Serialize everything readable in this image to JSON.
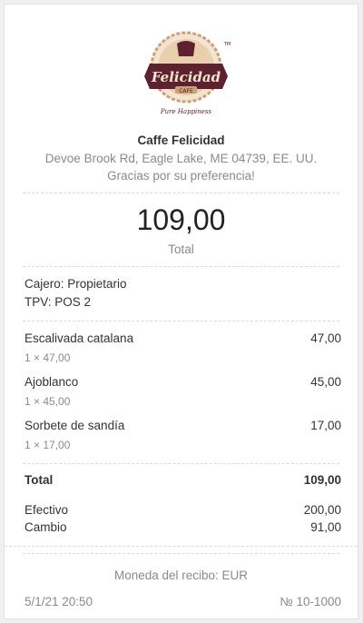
{
  "store": {
    "name": "Caffe Felicidad",
    "address": "Devoe Brook Rd, Eagle Lake, ME 04739, EE. UU.",
    "thanks": "Gracias por su preferencia!",
    "logo": {
      "brand": "Felicidad",
      "sub": "CAFE",
      "tagline": "Pure Happiness",
      "trademark": "TM",
      "colors": {
        "maroon": "#5e2130",
        "gold": "#c9a27a",
        "cream": "#f3e3cf"
      }
    }
  },
  "total": {
    "amount": "109,00",
    "caption": "Total"
  },
  "meta": {
    "cashier": "Cajero: Propietario",
    "pos": "TPV: POS 2"
  },
  "items": [
    {
      "name": "Escalivada catalana",
      "qty": "1 × 47,00",
      "price": "47,00"
    },
    {
      "name": "Ajoblanco",
      "qty": "1 × 45,00",
      "price": "45,00"
    },
    {
      "name": "Sorbete de sandía",
      "qty": "1 × 17,00",
      "price": "17,00"
    }
  ],
  "summary": {
    "total_label": "Total",
    "total_value": "109,00",
    "cash_label": "Efectivo",
    "cash_value": "200,00",
    "change_label": "Cambio",
    "change_value": "91,00"
  },
  "footer": {
    "currency": "Moneda del recibo: EUR",
    "datetime": "5/1/21 20:50",
    "receipt_number": "№ 10-1000"
  }
}
